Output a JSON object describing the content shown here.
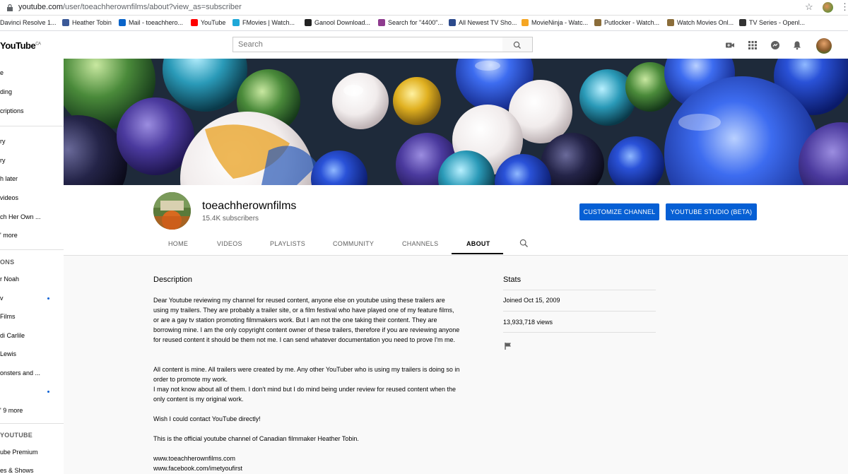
{
  "browser": {
    "url_host": "youtube.com",
    "url_path": "/user/toeachherownfilms/about?view_as=subscriber"
  },
  "bookmarks": [
    {
      "label": "Davinci Resolve 1...",
      "color": "#555555"
    },
    {
      "label": "Heather Tobin",
      "color": "#3b5998"
    },
    {
      "label": "Mail - toeachhero...",
      "color": "#0a64c9"
    },
    {
      "label": "YouTube",
      "color": "#ff0000"
    },
    {
      "label": "FMovies | Watch...",
      "color": "#1fa8d8"
    },
    {
      "label": "Ganool Download...",
      "color": "#222222"
    },
    {
      "label": "Search for \"4400\"...",
      "color": "#8e3b8e"
    },
    {
      "label": "All Newest TV Sho...",
      "color": "#2c4a8c"
    },
    {
      "label": "MovieNinja - Watc...",
      "color": "#f5a623"
    },
    {
      "label": "Putlocker - Watch...",
      "color": "#8b6d3a"
    },
    {
      "label": "Watch Movies Onl...",
      "color": "#8b6d3a"
    },
    {
      "label": "TV Series - Openl...",
      "color": "#333333"
    }
  ],
  "header": {
    "logo": "YouTube",
    "logo_region": "CA",
    "search_placeholder": "Search"
  },
  "sidebar": {
    "items": [
      {
        "label": "e"
      },
      {
        "label": "ding"
      },
      {
        "label": "criptions"
      },
      {
        "label": "ry"
      },
      {
        "label": "ry"
      },
      {
        "label": "h later"
      },
      {
        "label": " videos"
      },
      {
        "label": "ch Her Own ..."
      },
      {
        "label": "' more"
      },
      {
        "label": "ONS",
        "heading": true
      },
      {
        "label": "r Noah"
      },
      {
        "label": "v",
        "dot": true
      },
      {
        "label": "Films"
      },
      {
        "label": "di Carlile"
      },
      {
        "label": "Lewis"
      },
      {
        "label": "onsters and ..."
      },
      {
        "label": "",
        "dot": true
      },
      {
        "label": "' 9 more"
      },
      {
        "label": " YOUTUBE",
        "heading": true
      },
      {
        "label": "ube Premium"
      },
      {
        "label": "es & Shows"
      }
    ]
  },
  "channel": {
    "name": "toeachherownfilms",
    "subscribers": "15.4K subscribers",
    "customize_label": "CUSTOMIZE CHANNEL",
    "studio_label": "YOUTUBE STUDIO (BETA)",
    "tabs": [
      "HOME",
      "VIDEOS",
      "PLAYLISTS",
      "COMMUNITY",
      "CHANNELS",
      "ABOUT"
    ],
    "active_tab": "ABOUT"
  },
  "about": {
    "description_title": "Description",
    "paragraphs": [
      "Dear Youtube reviewing my channel for reused content, anyone else on youtube using these trailers are using my trailers.  They are probably a trailer site, or a film festival who have played one of my feature films, or are a gay tv station promoting filmmakers work.  But I am not the one taking their content.  They are borrowing mine.  I am the only copyright content owner of these trailers, therefore if you are reviewing anyone for reused content it should be them not me.  I can send whatever documentation you need to prove I'm me.",
      "All content is mine.  All trailers were created by me.  Any other YouTuber who is using my trailers is doing so in order to promote my work.\nI may not know about all of them.  I don't mind but I do mind being under review for reused content when the only content is my original work.",
      "Wish I could contact YouTube directly!",
      "This is the official youtube channel of Canadian filmmaker Heather Tobin.",
      "www.toeachherownfilms.com\nwww.facebook.com/imetyoufirst"
    ],
    "stats_title": "Stats",
    "joined": "Joined Oct 15, 2009",
    "views": "13,933,718 views"
  },
  "colors": {
    "accent": "#065fd4",
    "red": "#ff0000"
  }
}
